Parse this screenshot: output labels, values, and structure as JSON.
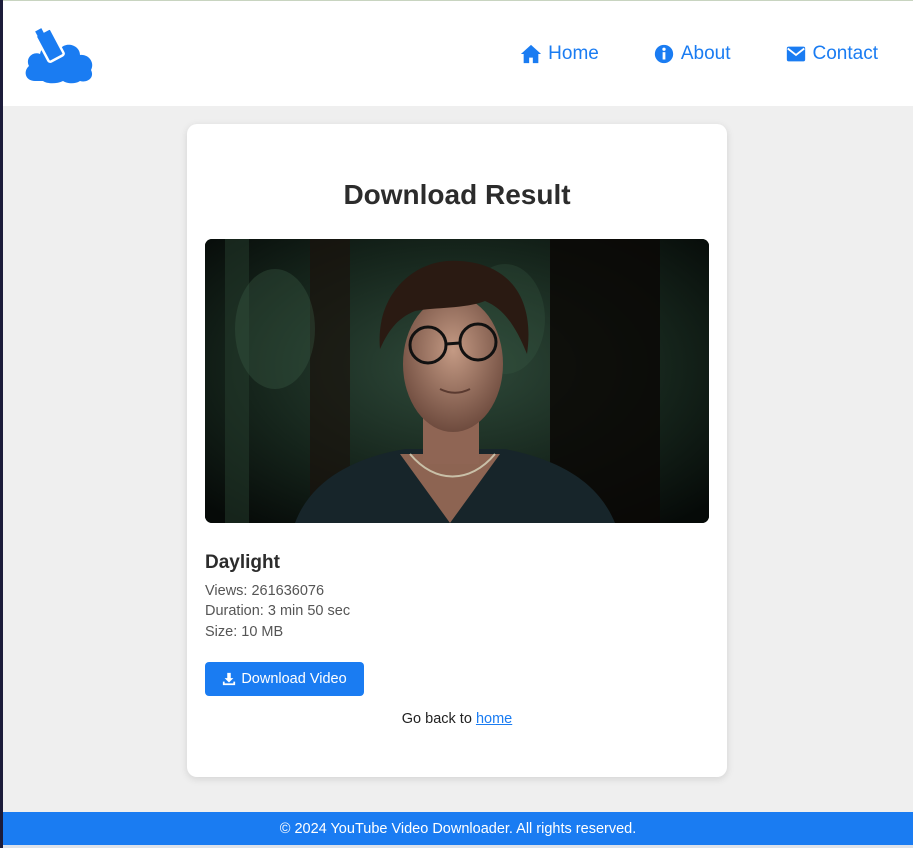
{
  "nav": {
    "home": "Home",
    "about": "About",
    "contact": "Contact"
  },
  "card": {
    "title": "Download Result"
  },
  "video": {
    "title": "Daylight",
    "views": "Views: 261636076",
    "duration": "Duration: 3 min 50 sec",
    "size": "Size: 10 MB"
  },
  "actions": {
    "download_label": "Download Video",
    "go_back_text": "Go back to ",
    "home_link": "home"
  },
  "footer": {
    "text": "© 2024 YouTube Video Downloader. All rights reserved."
  },
  "colors": {
    "accent": "#1a7cf2",
    "page_bg": "#efefef"
  }
}
